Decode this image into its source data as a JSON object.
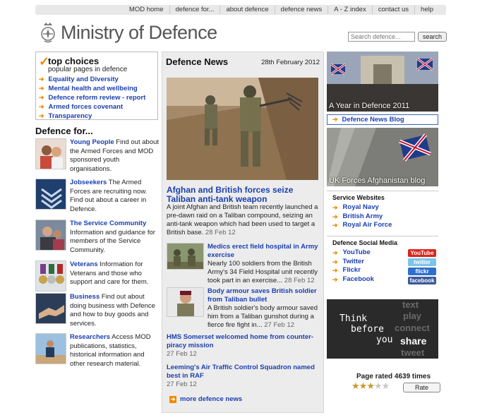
{
  "topnav": [
    "MOD home",
    "defence for...",
    "about defence",
    "defence news",
    "A - Z index",
    "contact us",
    "help"
  ],
  "header": {
    "title": "Ministry of Defence",
    "search_placeholder": "Search defence...",
    "search_button": "search"
  },
  "top_choices": {
    "title": "top choices",
    "subtitle": "popular pages in defence",
    "links": [
      "Equality and Diversity",
      "Mental health and wellbeing",
      "Defence reform review - report",
      "Armed forces covenant",
      "Transparency"
    ]
  },
  "defence_for": {
    "title": "Defence for...",
    "items": [
      {
        "title": "Young People",
        "text": "Find out about the Armed Forces and MOD sponsored youth organisations."
      },
      {
        "title": "Jobseekers",
        "text": "The Armed Forces are recruiting now. Find out about a career in Defence."
      },
      {
        "title": "The Service Community",
        "text": "Information and guidance for members of the Service Community."
      },
      {
        "title": "Veterans",
        "text": "Information for Veterans and those who support and care for them."
      },
      {
        "title": "Business",
        "text": "Find out about doing business with Defence and how to buy goods and services."
      },
      {
        "title": "Researchers",
        "text": "Access MOD publications, statistics, historical information and other research material."
      }
    ]
  },
  "news": {
    "title": "Defence News",
    "date": "28th February 2012",
    "lead": {
      "headline": "Afghan and British forces seize Taliban anti-tank weapon",
      "summary": "A joint Afghan and British team recently launched a pre-dawn raid on a Taliban compound, seizing an anti-tank weapon which had been used to target a British base.",
      "date": "28 Feb 12"
    },
    "stories": [
      {
        "headline": "Medics erect field hospital in Army exercise",
        "summary": "Nearly 100 soldiers from the British Army's 34 Field Hospital unit recently took part in an exercise...",
        "date": "28 Feb 12"
      },
      {
        "headline": "Body armour saves British soldier from Taliban bullet",
        "summary": "A British soldier's body armour saved him from a Taliban gunshot during a fierce fire fight in...",
        "date": "27 Feb 12"
      },
      {
        "headline": "HMS Somerset welcomed home from counter-piracy mission",
        "date": "27 Feb 12"
      },
      {
        "headline": "Leeming's Air Traffic Control Squadron named best in RAF",
        "date": "27 Feb 12"
      }
    ],
    "more": "more defence news"
  },
  "right": {
    "year_caption": "A Year in Defence 2011",
    "blog_link": "Defence News Blog",
    "afghan_caption": "UK Forces Afghanistan blog",
    "services_title": "Service Websites",
    "services": [
      "Royal Navy",
      "British Army",
      "Royal Air Force"
    ],
    "social_title": "Defence Social Media",
    "social": [
      {
        "label": "YouTube",
        "badge": "YouTube",
        "color": "#d9261c"
      },
      {
        "label": "Twitter",
        "badge": "twitter",
        "color": "#7cc4e8"
      },
      {
        "label": "Flickr",
        "badge": "flickr",
        "color": "#2f6fcf"
      },
      {
        "label": "Facebook",
        "badge": "facebook",
        "color": "#3b5998"
      }
    ],
    "think": {
      "left": [
        "Think",
        "before",
        "you"
      ],
      "share": "share",
      "words": [
        "text",
        "play",
        "connect",
        "tweet"
      ]
    },
    "rating": {
      "text": "Page rated 4639 times",
      "stars": 3,
      "max_stars": 5,
      "button": "Rate"
    }
  },
  "colors": {
    "link": "#1a3fb0",
    "accent": "#f08a00"
  }
}
